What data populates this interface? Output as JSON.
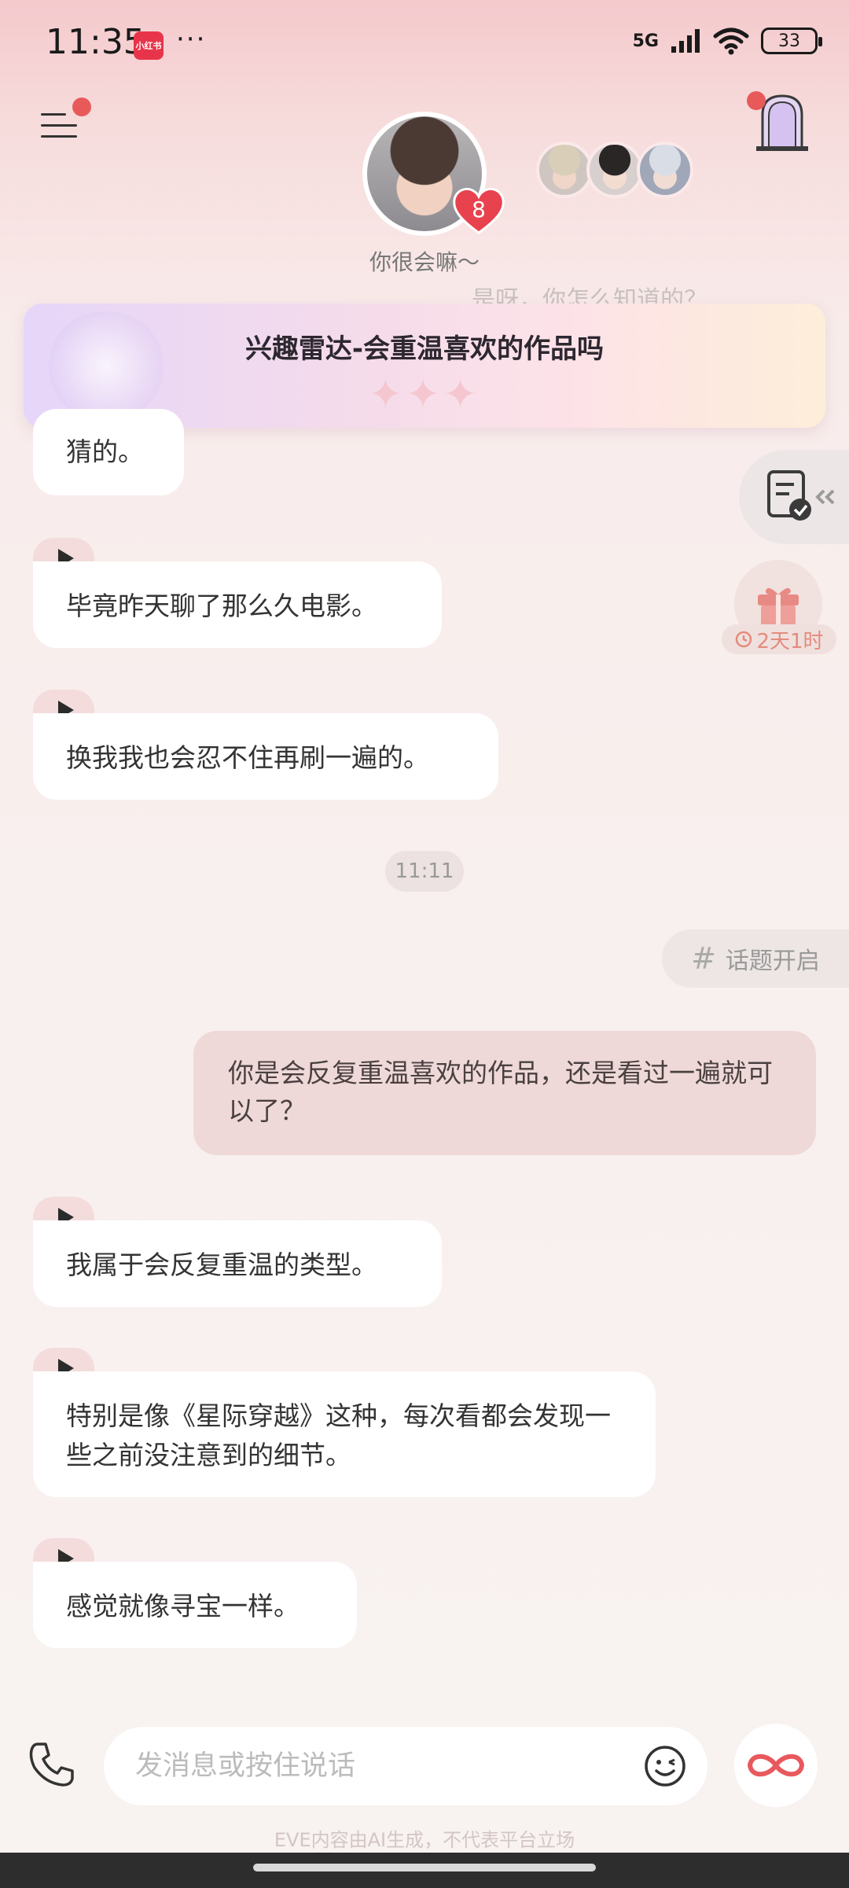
{
  "status_bar": {
    "time": "11:35",
    "app_icon_text": "小红书",
    "more": "···",
    "network": "5G",
    "battery": "33"
  },
  "header": {
    "affection_level": "8",
    "status_text": "你很会嘛～"
  },
  "banner": {
    "faded_text": "是呀，你怎么知道的？",
    "title": "兴趣雷达-会重温喜欢的作品吗",
    "stars": "✦✦✦"
  },
  "side": {
    "gift_timer": "2天1时"
  },
  "messages": [
    {
      "sender": "bot",
      "text": "猜的。"
    },
    {
      "sender": "bot",
      "text": "毕竟昨天聊了那么久电影。"
    },
    {
      "sender": "bot",
      "text": "换我我也会忍不住再刷一遍的。"
    },
    {
      "sender": "user",
      "text": "你是会反复重温喜欢的作品，还是看过一遍就可以了？"
    },
    {
      "sender": "bot",
      "text": "我属于会反复重温的类型。"
    },
    {
      "sender": "bot",
      "text": "特别是像《星际穿越》这种，每次看都会发现一些之前没注意到的细节。"
    },
    {
      "sender": "bot",
      "text": "感觉就像寻宝一样。"
    }
  ],
  "time_divider": "11:11",
  "topic_button": {
    "icon": "#",
    "label": "话题开启"
  },
  "composer": {
    "placeholder": "发消息或按住说话",
    "disclaimer": "EVE内容由AI生成，不代表平台立场"
  },
  "colors": {
    "accent": "#e85a5a",
    "user_bubble": "#efd9d8",
    "bot_bubble": "#ffffff",
    "play_tab": "#f4dcdc"
  }
}
